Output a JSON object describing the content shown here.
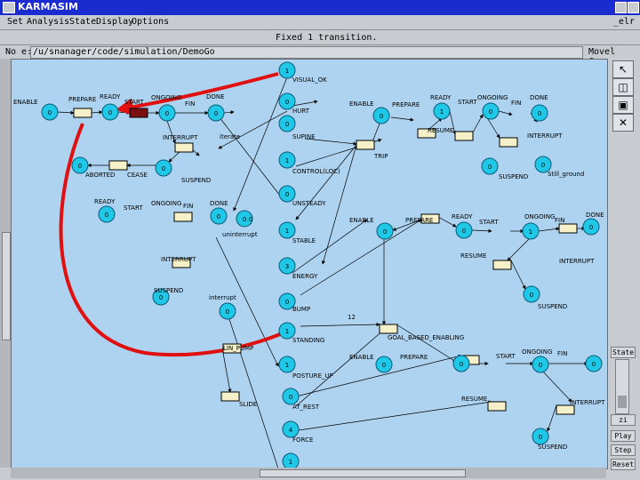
{
  "window": {
    "title": "KARMASIM"
  },
  "menu": {
    "items": [
      "Set",
      "Analysis",
      "State",
      "Display",
      "Options"
    ],
    "right": "_elr"
  },
  "status": {
    "text": "Fixed 1 transition."
  },
  "path": {
    "label": "No e:",
    "value": "/u/snanager/code/simulation/DemoGo",
    "mode": "Movel Copy (Arc)"
  },
  "tools": [
    "pointer-icon",
    "place-tool-icon",
    "transition-tool-icon",
    "delete-icon"
  ],
  "side": {
    "state_label": "State",
    "play": "Play",
    "step": "Step",
    "reset": "Reset",
    "zoom": "zi"
  },
  "net": {
    "places": [
      {
        "label": "0"
      },
      {
        "label": "0"
      },
      {
        "label": "0"
      },
      {
        "label": "0"
      },
      {
        "label": "0"
      },
      {
        "label": "0"
      },
      {
        "label": "0"
      },
      {
        "label": "0"
      },
      {
        "label": "0"
      },
      {
        "label": "0"
      },
      {
        "label": "0"
      },
      {
        "label": "1"
      },
      {
        "label": "0"
      },
      {
        "label": "0"
      },
      {
        "label": "1"
      },
      {
        "label": "0"
      },
      {
        "label": "1"
      },
      {
        "label": "3"
      },
      {
        "label": "0"
      },
      {
        "label": "1"
      },
      {
        "label": "1"
      },
      {
        "label": "0"
      },
      {
        "label": "4"
      },
      {
        "label": "1"
      },
      {
        "label": "0"
      },
      {
        "label": "1"
      },
      {
        "label": "0"
      },
      {
        "label": "0"
      },
      {
        "label": "0"
      },
      {
        "label": "0"
      },
      {
        "label": "0"
      },
      {
        "label": "0"
      },
      {
        "label": "1"
      },
      {
        "label": "0"
      },
      {
        "label": "0"
      },
      {
        "label": "0"
      },
      {
        "label": "0"
      },
      {
        "label": "0"
      },
      {
        "label": "0"
      },
      {
        "label": "0"
      },
      {
        "label": "0"
      },
      {
        "label": "0"
      },
      {
        "label": "0"
      }
    ],
    "labels": [
      "ENABLE",
      "PREPARE",
      "READY",
      "START",
      "ONGOING",
      "FIN",
      "DONE",
      "INTERRUPT",
      "iterate",
      "ABORTED",
      "CEASE",
      "SUSPEND",
      "READY",
      "START",
      "ONGOING",
      "FIN",
      "DONE",
      "uninterrupt",
      "0",
      "INTERRUPT",
      "SUSPEND",
      "interrupt",
      "VISUAL_OK",
      "HURT",
      "SUPINE",
      "CONTROL(LOC)",
      "TRIP",
      "UNSTEADY",
      "STABLE",
      "ENERGY",
      "BUMP",
      "STANDING",
      "POSTURE_UP",
      "AT_REST",
      "FORCE",
      "ENABLE",
      "PREPARE",
      "READY",
      "START",
      "ONGOING",
      "FIN",
      "DONE",
      "RESUME",
      "INTERRUPT",
      "SUSPEND",
      "Still_ground",
      "ENABLE",
      "PREPARE",
      "READY",
      "START",
      "ONGOING",
      "FIN",
      "DONE",
      "RESUME",
      "INTERRUPT",
      "SUSPEND",
      "0",
      "GOAL_BASED_ENABLING",
      "12",
      "ENABLE",
      "PREPARE",
      "START",
      "ONGOING",
      "FIN",
      "RESUME",
      "INTERRUPT",
      "SUSPEND",
      "LIN_PUMP",
      "SLIDE"
    ]
  },
  "colors": {
    "canvas": "#aed3f0",
    "place": "#1ec8e6",
    "transition": "#f5f0c8",
    "selected": "#7a1010",
    "highlight": "#e01010"
  }
}
